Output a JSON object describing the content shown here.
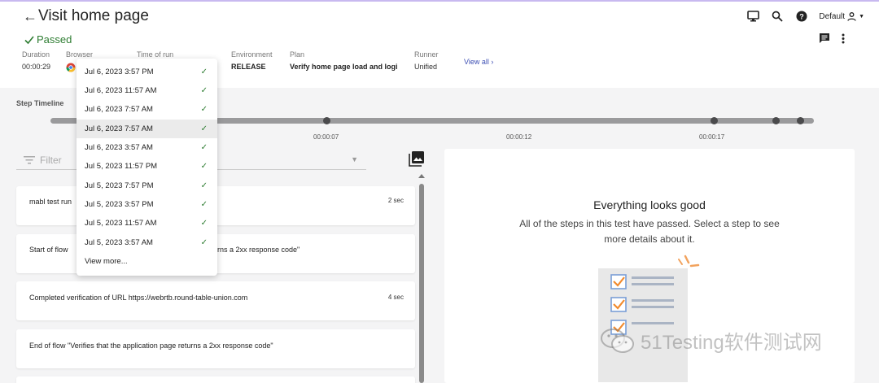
{
  "header": {
    "title": "Visit home page",
    "user_label": "Default"
  },
  "status": {
    "label": "Passed",
    "color": "#2e7d32"
  },
  "meta": {
    "duration_label": "Duration",
    "duration_value": "00:00:29",
    "browser_label": "Browser",
    "time_label": "Time of run",
    "environment_label": "Environment",
    "environment_value": "RELEASE",
    "plan_label": "Plan",
    "plan_value": "Verify home page load and logi",
    "runner_label": "Runner",
    "runner_value": "Unified",
    "view_all": "View all"
  },
  "timeline": {
    "label": "Step Timeline",
    "ticks": [
      "00:00:07",
      "00:00:12",
      "00:00:17"
    ]
  },
  "filter": {
    "placeholder": "Filter"
  },
  "steps": [
    {
      "text": "mabl test run",
      "duration": "2 sec"
    },
    {
      "text": "Start of flow",
      "text_tail": "rns a 2xx response code\"",
      "duration": ""
    },
    {
      "text": "Completed verification of URL https://webrtb.round-table-union.com",
      "duration": "4 sec"
    },
    {
      "text": "End of flow \"Verifies that the application page returns a 2xx response code\"",
      "duration": ""
    }
  ],
  "detail": {
    "title": "Everything looks good",
    "description": "All of the steps in this test have passed. Select a step to see more details about it."
  },
  "run_dropdown": {
    "items": [
      {
        "label": "Jul 6, 2023 3:57 PM"
      },
      {
        "label": "Jul 6, 2023 11:57 AM"
      },
      {
        "label": "Jul 6, 2023 7:57 AM"
      },
      {
        "label": "Jul 6, 2023 7:57 AM",
        "selected": true
      },
      {
        "label": "Jul 6, 2023 3:57 AM"
      },
      {
        "label": "Jul 5, 2023 11:57 PM"
      },
      {
        "label": "Jul 5, 2023 7:57 PM"
      },
      {
        "label": "Jul 5, 2023 3:57 PM"
      },
      {
        "label": "Jul 5, 2023 11:57 AM"
      },
      {
        "label": "Jul 5, 2023 3:57 AM"
      }
    ],
    "view_more": "View more..."
  },
  "watermark": {
    "text": "51Testing软件测试网"
  },
  "icons": [
    "back-arrow-icon",
    "monitor-icon",
    "search-icon",
    "help-icon",
    "user-icon",
    "comment-icon",
    "more-vert-icon",
    "check-icon",
    "chrome-icon",
    "chevron-right-icon",
    "filter-icon",
    "image-icon",
    "wechat-icon"
  ]
}
